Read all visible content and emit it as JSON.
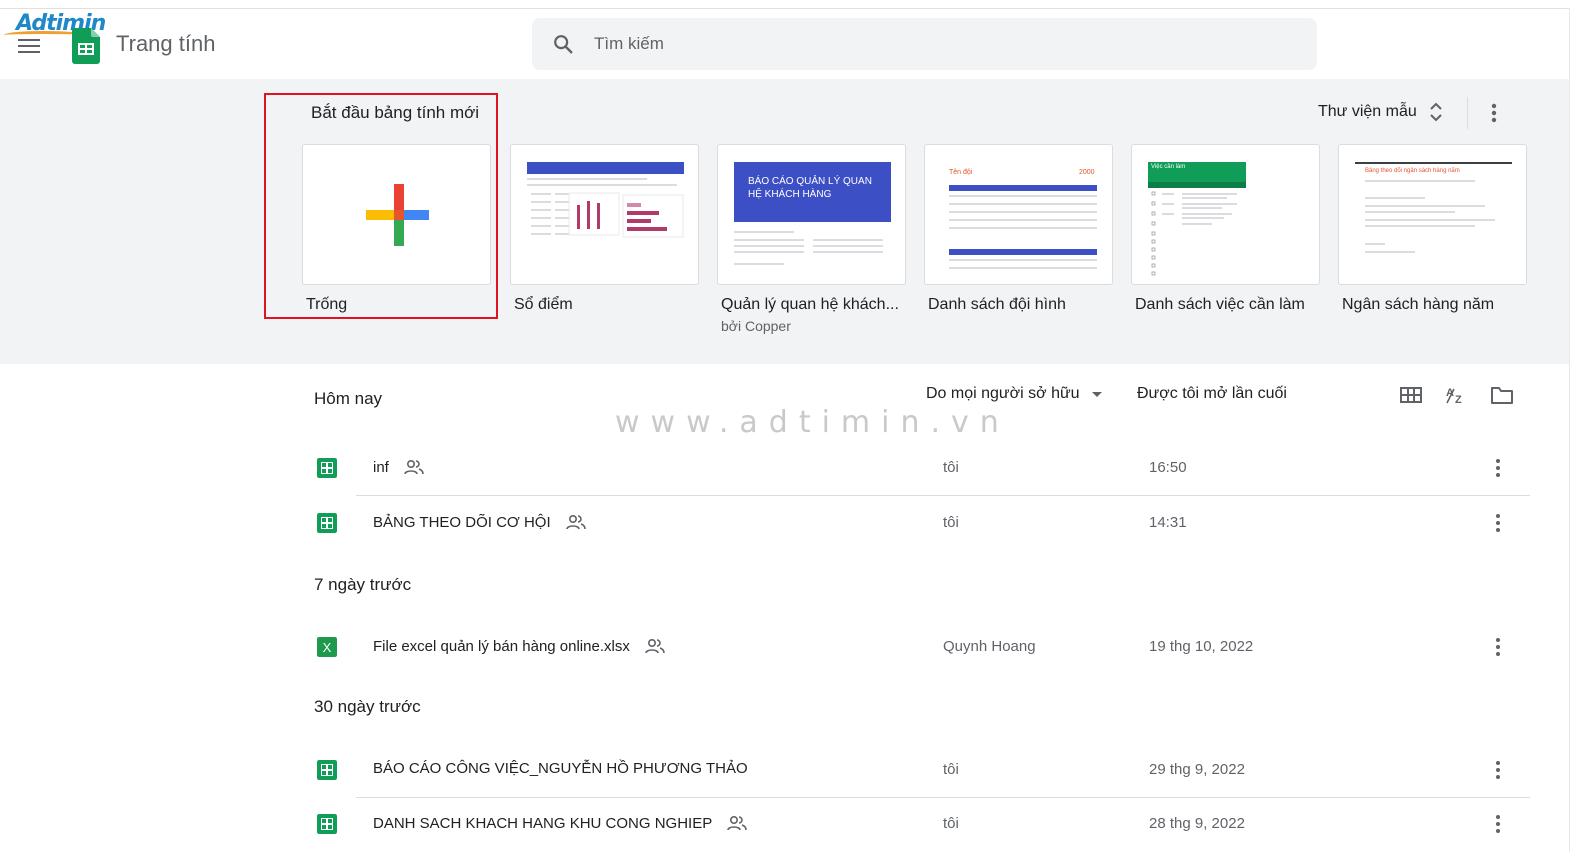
{
  "watermark": {
    "logo_text": "Adtimin",
    "site_text": "www.adtimin.vn"
  },
  "header": {
    "app_title": "Trang tính",
    "search_placeholder": "Tìm kiếm"
  },
  "gallery": {
    "title": "Bắt đầu bảng tính mới",
    "library_label": "Thư viện mẫu",
    "templates": [
      {
        "name": "Trống",
        "sub": ""
      },
      {
        "name": "Sổ điểm",
        "sub": ""
      },
      {
        "name": "Quản lý quan hệ khách...",
        "sub": "bởi Copper"
      },
      {
        "name": "Danh sách đội hình",
        "sub": ""
      },
      {
        "name": "Danh sách việc cần làm",
        "sub": ""
      },
      {
        "name": "Ngân sách hàng năm",
        "sub": ""
      }
    ],
    "thumb_text": {
      "crm_heading": "BÁO CÁO QUẢN LÝ QUAN HỆ KHÁCH HÀNG",
      "roster_title": "Tên đội",
      "roster_year": "2000",
      "todo_title": "Việc cần làm",
      "budget_title": "Bảng theo dõi ngân sách hàng năm"
    }
  },
  "list": {
    "owner_filter": "Do mọi người sở hữu",
    "opened_header": "Được tôi mở lần cuối",
    "sections": [
      {
        "title": "Hôm nay",
        "files": [
          {
            "name": "inf",
            "shared": true,
            "type": "sheets",
            "owner": "tôi",
            "date": "16:50"
          },
          {
            "name": "BẢNG THEO DÕI CƠ HỘI",
            "shared": true,
            "type": "sheets",
            "owner": "tôi",
            "date": "14:31"
          }
        ]
      },
      {
        "title": "7 ngày trước",
        "files": [
          {
            "name": "File excel quản lý bán hàng online.xlsx",
            "shared": true,
            "type": "excel",
            "owner": "Quynh Hoang",
            "date": "19 thg 10, 2022"
          }
        ]
      },
      {
        "title": "30 ngày trước",
        "files": [
          {
            "name": "BÁO CÁO CÔNG VIỆC_NGUYỄN HỒ PHƯƠNG THẢO",
            "shared": false,
            "type": "sheets",
            "owner": "tôi",
            "date": "29 thg 9, 2022"
          },
          {
            "name": "DANH SACH KHACH HANG KHU CONG NGHIEP",
            "shared": true,
            "type": "sheets",
            "owner": "tôi",
            "date": "28 thg 9, 2022"
          }
        ]
      }
    ]
  },
  "colors": {
    "sheets_green": "#0f9d58",
    "excel_green": "#1d9a4e",
    "highlight_red": "#e0141e",
    "gallery_bg": "#f1f3f4"
  },
  "icons": [
    "menu-icon",
    "sheets-app-icon",
    "search-icon",
    "unfold-icon",
    "more-vert-icon",
    "plus-icon",
    "grid-view-icon",
    "sort-az-icon",
    "folder-icon",
    "shared-people-icon"
  ]
}
